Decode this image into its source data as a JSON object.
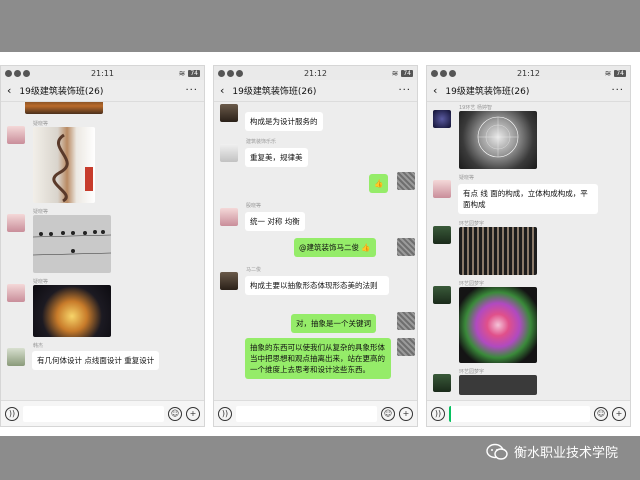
{
  "phones": [
    {
      "status": {
        "time": "21:11",
        "battery": "74"
      },
      "title": "19级建筑装饰班(26)",
      "messages": [
        {
          "sender": "疑晓等",
          "type": "image",
          "image": "staircase-photo"
        },
        {
          "sender": "疑晓等",
          "type": "image",
          "image": "birds-on-wire-photo"
        },
        {
          "sender": "疑晓等",
          "type": "image",
          "image": "night-lights-photo"
        },
        {
          "sender": "韩杰",
          "type": "text",
          "text": "有几何体设计 点线面设计 重复设计"
        }
      ]
    },
    {
      "status": {
        "time": "21:12",
        "battery": "74"
      },
      "title": "19级建筑装饰班(26)",
      "messages": [
        {
          "sender": "",
          "type": "text",
          "text": "构成是为设计服务的"
        },
        {
          "sender": "建筑装饰乐乐",
          "type": "text",
          "text": "重复美，规律美"
        },
        {
          "sender": "",
          "type": "sticker",
          "text": "👍",
          "outgoing": true
        },
        {
          "sender": "殷晓等",
          "type": "text",
          "text": "统一  对称  均衡"
        },
        {
          "sender": "",
          "type": "text",
          "text": "@建筑装饰马二俊 👍",
          "outgoing": true
        },
        {
          "sender": "马二俊",
          "type": "text",
          "text": "构成主要以抽象形态体现形态美的法则"
        },
        {
          "sender": "",
          "type": "text",
          "text": "对，抽象是一个关键词",
          "outgoing": true
        },
        {
          "sender": "",
          "type": "text",
          "text": "抽象的东西可以使我们从复杂的具象形体当中把思想和观点抽离出来，站在更高的一个维度上去思考和设计这些东西。",
          "outgoing": true
        }
      ]
    },
    {
      "status": {
        "time": "21:12",
        "battery": "74"
      },
      "title": "19级建筑装饰班(26)",
      "messages": [
        {
          "sender": "19环艺 杨婷智",
          "type": "image",
          "image": "sphere-sculpture-photo"
        },
        {
          "sender": "疑晓等",
          "type": "text",
          "text": "有点 线 面的构成，立体构成构成，平面构成"
        },
        {
          "sender": "环艺园梦宇",
          "type": "image",
          "image": "grid-facade-photo"
        },
        {
          "sender": "环艺园梦宇",
          "type": "image",
          "image": "radial-light-photo"
        },
        {
          "sender": "环艺园梦宇",
          "type": "image",
          "image": "partial-photo"
        }
      ]
    }
  ],
  "watermark": {
    "text": "衡水职业技术学院"
  },
  "icons": {
    "voice": "voice-icon",
    "emoji": "emoji-icon",
    "plus": "plus-icon",
    "back": "back-chevron-icon",
    "more": "more-icon"
  },
  "colors": {
    "outgoing_bubble": "#95ec69",
    "incoming_bubble": "#ffffff",
    "background": "#8c8c8c",
    "chat_bg": "#ededed"
  }
}
